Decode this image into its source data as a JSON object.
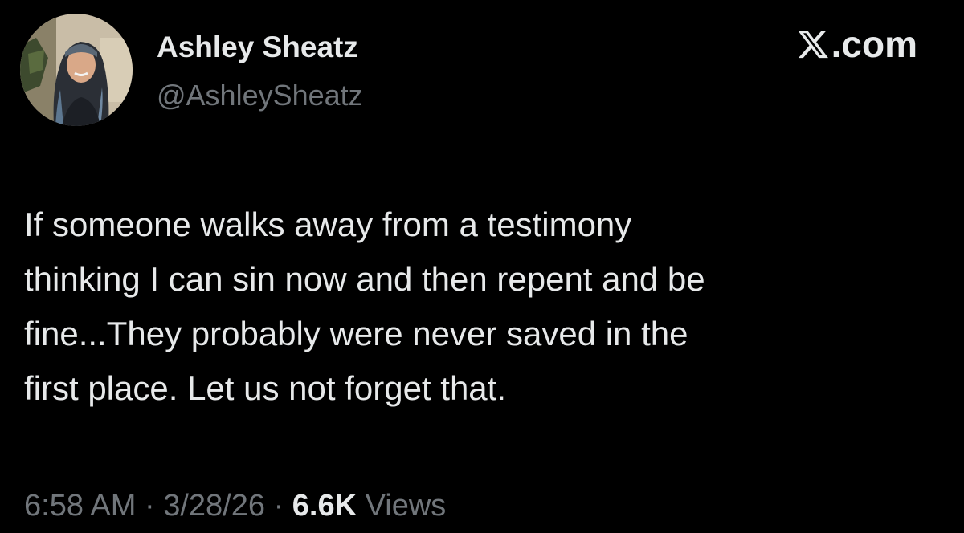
{
  "author": {
    "display_name": "Ashley Sheatz",
    "handle": "@AshleySheatz"
  },
  "brand": {
    "label": ".com",
    "icon": "x-logo-icon"
  },
  "tweet": {
    "text": "If someone walks away from a testimony\nthinking I can sin now and then repent and be\nfine...They probably were never saved in the\nfirst place. Let us not forget that."
  },
  "meta": {
    "time": "6:58 AM",
    "separator": "·",
    "date": "3/28/26",
    "views_count": "6.6K",
    "views_label": "Views"
  },
  "colors": {
    "background": "#000000",
    "primary_text": "#e7e9ea",
    "secondary_text": "#71767b"
  }
}
